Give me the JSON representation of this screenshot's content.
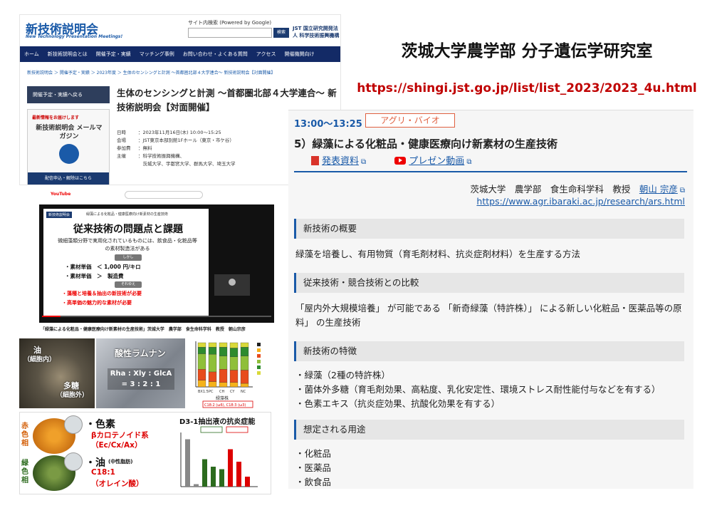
{
  "header": {
    "lab_title": "茨城大学農学部 分子遺伝学研究室",
    "source_url": "https://shingi.jst.go.jp/list/list_2023/2023_4u.html"
  },
  "site": {
    "logo": "新技術説明会",
    "logo_sub": "New Technology Presentation Meetings!",
    "search_label": "サイト内検索 (Powered by Google)",
    "search_button": "検索",
    "org": "JST 国立研究開発法人 科学技術振興機構",
    "nav": [
      "ホーム",
      "新技術説明会とは",
      "開催予定・実績",
      "マッチング事例",
      "お問い合わせ・よくある質問",
      "アクセス",
      "開催機関向け"
    ],
    "breadcrumb": "新技術説明会 ＞ 開催予定・実績 ＞ 2023年度 ＞ 生体のセンシングと計測 ～首都圏北部４大学連合～ 新技術説明会【対面開催】",
    "side_button": "開催予定・実績へ戻る",
    "mag_notice": "最新情報をお届けします",
    "mag_title": "新技術説明会 メールマガジン",
    "mag_button": "配信申込・解除はこちら",
    "event_title": "生体のセンシングと計測 ～首都圏北部４大学連合～ 新技術説明会【対面開催】",
    "info": [
      {
        "k": "日時",
        "v": "：2023年11月16日(木) 10:00～15:25"
      },
      {
        "k": "会場",
        "v": "：JST東京本部別館1Fホール（東京・市ケ谷）"
      },
      {
        "k": "参加費",
        "v": "：無料"
      },
      {
        "k": "主催",
        "v": "：科学技術振興機構、"
      },
      {
        "k": "",
        "v": "　茨城大学、宇都宮大学、群馬大学、埼玉大学"
      }
    ]
  },
  "video": {
    "yt_logo": "YouTube",
    "slide_tag": "新技術説明会",
    "slide_head": "緑藻による化粧品・健康医療向け新素材の生産技術",
    "slide_title": "従来技術の問題点と課題",
    "slide_p": "微細藻類分野で実用化されているものには、飲食品・化粧品等の素材製造法がある",
    "pill1": "しかし",
    "b1": "・素材単価　＜ 1,000 円/キロ",
    "b2": "・素材単価　＞　製造費",
    "pill2": "それゆえ",
    "r1": "・藻種と培養＆抽出の新技術が必要",
    "r2": "・高単価の魅力的な素材が必要",
    "caption": "「緑藻による化粧品・健康医療向け新素材の生産技術」茨城大学　農学部　食生命科学科　教授　朝山宗彦"
  },
  "photo1": {
    "oil": "油",
    "oil_sub": "（細胞内）",
    "sugar": "多糖",
    "sugar_sub": "（細胞外）"
  },
  "photo2": {
    "label": "酸性ラムナン",
    "ratio_head": "Rha : Xly : GlcA",
    "ratio": "= 3 : 2 : 1"
  },
  "chart1": {
    "legend_label": "C18:2 (ω6), C18:3 (ω3)",
    "xlabel": "緑藻株",
    "categories": [
      "BX1.5",
      "PC",
      "CH",
      "CY",
      "NC"
    ]
  },
  "panel": {
    "red": "赤色相",
    "green": "緑色相",
    "pigment_head": "・色素",
    "pigment_1": "βカロテノイド系",
    "pigment_2": "（Ec/Cx/Ax）",
    "oil_head": "・油",
    "oil_note": "(中性脂肪)",
    "oil_1": "C18:1",
    "oil_2": "（オレイン酸）",
    "chart_title": "D3-1抽出液の抗炎症能"
  },
  "card": {
    "time": "13:00～13:25",
    "category": "アグリ・バイオ",
    "title": "5）緑藻による化粧品・健康医療向け新素材の生産技術",
    "link_pdf": "発表資料",
    "link_video": "プレゼン動画",
    "presenter": "茨城大学　農学部　食生命科学科　教授",
    "presenter_name": "朝山 宗彦",
    "lab_url": "https://www.agr.ibaraki.ac.jp/research/ars.html",
    "sections": [
      {
        "title": "新技術の概要",
        "lines": [
          "緑藻を培養し、有用物質（育毛剤材料、抗炎症剤材料）を生産する方法"
        ]
      },
      {
        "title": "従来技術・競合技術との比較",
        "lines": [
          "「屋内外大規模培養」 が可能である 「新奇緑藻（特許株）」 による新しい化粧品・医薬品等の原",
          "料」 の生産技術"
        ]
      },
      {
        "title": "新技術の特徴",
        "lines": [
          "・緑藻（2種の特許株）",
          "・菌体外多糖（育毛剤効果、高粘度、乳化安定性、環境ストレス耐性能付与などを有する）",
          "・色素エキス（抗炎症効果、抗酸化効果を有する）"
        ]
      },
      {
        "title": "想定される用途",
        "lines": [
          "・化粧品",
          "・医薬品",
          "・飲食品"
        ]
      }
    ]
  }
}
